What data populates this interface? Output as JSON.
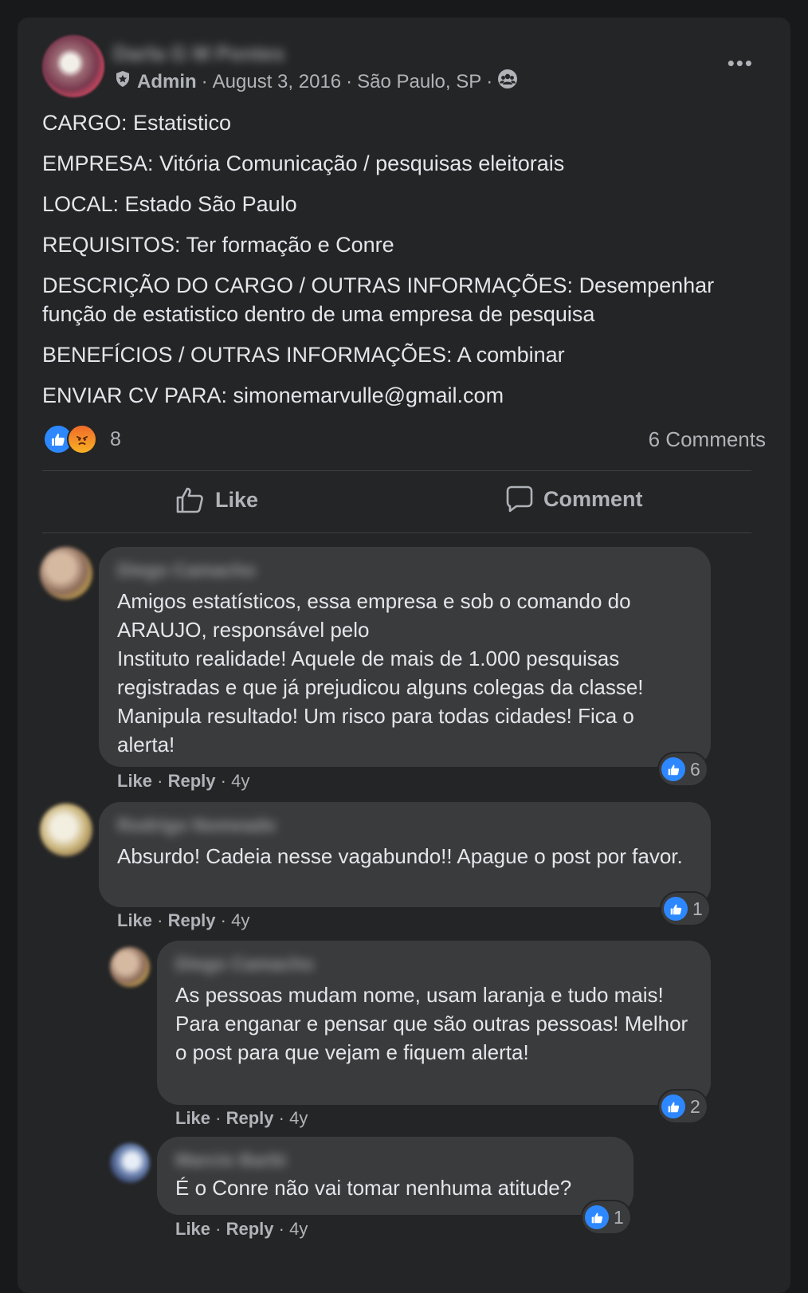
{
  "post": {
    "author_name": "Darla G M Pontes",
    "role": "Admin",
    "date": "August 3, 2016",
    "location": "São Paulo, SP",
    "separator": "·",
    "more_label": "•••",
    "lines": [
      "CARGO:  Estatistico",
      "EMPRESA:  Vitória Comunicação / pesquisas eleitorais",
      "LOCAL:  Estado São Paulo",
      "REQUISITOS:  Ter formação e Conre",
      "DESCRIÇÃO DO CARGO / OUTRAS INFORMAÇÕES:  Desempenhar função de estatistico dentro de uma empresa de pesquisa",
      "BENEFÍCIOS / OUTRAS INFORMAÇÕES:  A combinar",
      "ENVIAR CV PARA:  simonemarvulle@gmail.com"
    ],
    "reaction_count": "8",
    "comments_count": "6 Comments",
    "like_label": "Like",
    "comment_label": "Comment"
  },
  "comments": [
    {
      "author": "Diego Camacho",
      "text": "Amigos estatísticos, essa empresa e sob o comando do ARAUJO, responsável pelo\nInstituto realidade! Aquele de mais de 1.000 pesquisas registradas e que já prejudicou alguns colegas da classe! Manipula resultado! Um risco para todas cidades! Fica o alerta!",
      "like": "Like",
      "reply": "Reply",
      "time": "4y",
      "likes": "6"
    },
    {
      "author": "Rodrigo Nomeado",
      "text": "Absurdo! Cadeia nesse vagabundo!! Apague o post por favor.",
      "like": "Like",
      "reply": "Reply",
      "time": "4y",
      "likes": "1"
    },
    {
      "author": "Diego Camacho",
      "text": "As pessoas mudam nome, usam laranja e tudo mais! Para enganar e pensar que são outras pessoas! Melhor o post para que vejam e fiquem alerta!",
      "like": "Like",
      "reply": "Reply",
      "time": "4y",
      "likes": "2"
    },
    {
      "author": "Marcio Barbi",
      "text": "É o Conre não vai tomar nenhuma atitude?",
      "like": "Like",
      "reply": "Reply",
      "time": "4y",
      "likes": "1"
    }
  ]
}
